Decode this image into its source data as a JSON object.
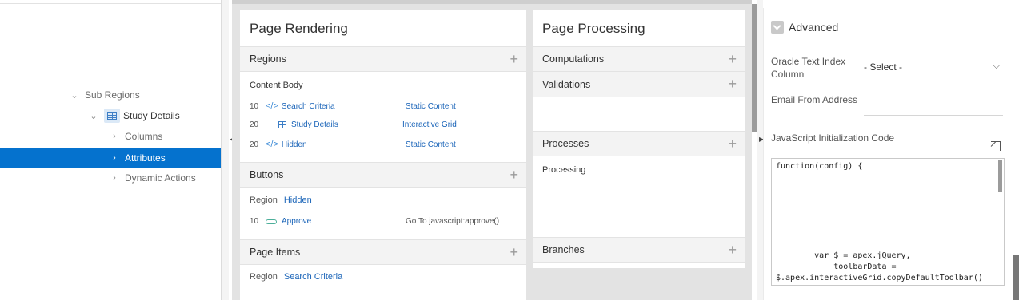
{
  "tree": {
    "items": [
      {
        "label": "Sub Regions",
        "chevron": "v"
      },
      {
        "label": "Study Details",
        "chevron": "v"
      },
      {
        "label": "Columns",
        "chevron": ">"
      },
      {
        "label": "Attributes",
        "chevron": ">"
      },
      {
        "label": "Dynamic Actions",
        "chevron": ">"
      }
    ],
    "selected_index": 3
  },
  "rendering": {
    "title": "Page Rendering",
    "regions": {
      "header": "Regions",
      "group": "Content Body",
      "rows": [
        {
          "seq": "10",
          "name": "Search Criteria",
          "type": "Static Content",
          "icon": "code-icon"
        },
        {
          "seq": "20",
          "name": "Study Details",
          "type": "Interactive Grid",
          "icon": "grid-icon"
        },
        {
          "seq": "20",
          "name": "Hidden",
          "type": "Static Content",
          "icon": "code-icon"
        }
      ]
    },
    "buttons": {
      "header": "Buttons",
      "region_label": "Region",
      "region_name": "Hidden",
      "rows": [
        {
          "seq": "10",
          "name": "Approve",
          "action": "Go To javascript:approve()",
          "icon": "button-icon"
        }
      ]
    },
    "items": {
      "header": "Page Items",
      "region_label": "Region",
      "region_name": "Search Criteria"
    }
  },
  "processing": {
    "title": "Page Processing",
    "computations": "Computations",
    "validations": "Validations",
    "processes": "Processes",
    "processes_group": "Processing",
    "branches": "Branches"
  },
  "props": {
    "group": "Advanced",
    "oracle_label": "Oracle Text Index Column",
    "oracle_value": "- Select -",
    "email_label": "Email From Address",
    "email_value": "",
    "js_label": "JavaScript Initialization Code",
    "code_lines": [
      "function(config) {",
      "        var $ = apex.jQuery,",
      "            toolbarData =",
      "$.apex.interactiveGrid.copyDefaultToolbar()"
    ]
  }
}
